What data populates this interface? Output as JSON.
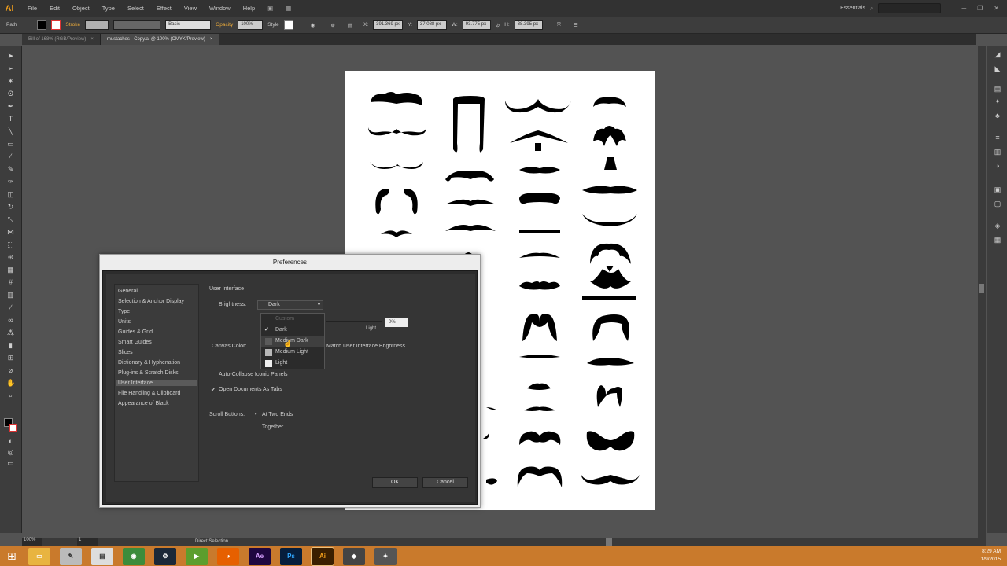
{
  "app": {
    "logo": "Ai"
  },
  "menu": [
    "File",
    "Edit",
    "Object",
    "Type",
    "Select",
    "Effect",
    "View",
    "Window",
    "Help"
  ],
  "workspace": {
    "label": "Essentials"
  },
  "controlbar": {
    "selection": "Path",
    "stroke_label": "Stroke",
    "brush_label": "Basic",
    "opacity_label": "Opacity",
    "opacity_value": "100%",
    "style_label": "Style",
    "x_value": "391.369 px",
    "y_value": "37.088 px",
    "w_value": "93.775 px",
    "h_value": "38.395 px"
  },
  "tabs": [
    {
      "label": "Bill of 168% (RGB/Preview)"
    },
    {
      "label": "mustaches - Copy.ai @ 100% (CMYK/Preview)"
    }
  ],
  "status": {
    "zoom": "100%",
    "page": "1",
    "tool": "Direct Selection"
  },
  "dialog": {
    "title": "Preferences",
    "categories": [
      "General",
      "Selection & Anchor Display",
      "Type",
      "Units",
      "Guides & Grid",
      "Smart Guides",
      "Slices",
      "Dictionary & Hyphenation",
      "Plug-ins & Scratch Disks",
      "User Interface",
      "File Handling & Clipboard",
      "Appearance of Black"
    ],
    "selected_category": "User Interface",
    "section_title": "User Interface",
    "brightness_label": "Brightness:",
    "brightness_value": "Dark",
    "brightness_options": [
      {
        "label": "Dark",
        "checked": true,
        "swatch": ""
      },
      {
        "label": "Medium Dark",
        "checked": false,
        "swatch": "#5a5a5a"
      },
      {
        "label": "Medium Light",
        "checked": false,
        "swatch": "#b8b8b8"
      },
      {
        "label": "Light",
        "checked": false,
        "swatch": "#eeeeee"
      }
    ],
    "custom_option": "Custom",
    "light_label": "Light",
    "brightness_pct": "0%",
    "canvas_color_label": "Canvas Color:",
    "canvas_match": "Match User Interface Brightness",
    "auto_collapse": "Auto-Collapse Iconic Panels",
    "open_docs_tabs": "Open Documents As Tabs",
    "scroll_buttons_label": "Scroll Buttons:",
    "scroll_option_1": "At Two Ends",
    "scroll_option_2": "Together",
    "ok_label": "OK",
    "cancel_label": "Cancel"
  },
  "taskbar": {
    "apps": [
      "Ae",
      "Ps",
      "Ai"
    ],
    "time": "8:29 AM",
    "date": "1/9/2015"
  },
  "colors": {
    "accent": "#f7a21b",
    "taskbar": "#c97a2c"
  }
}
